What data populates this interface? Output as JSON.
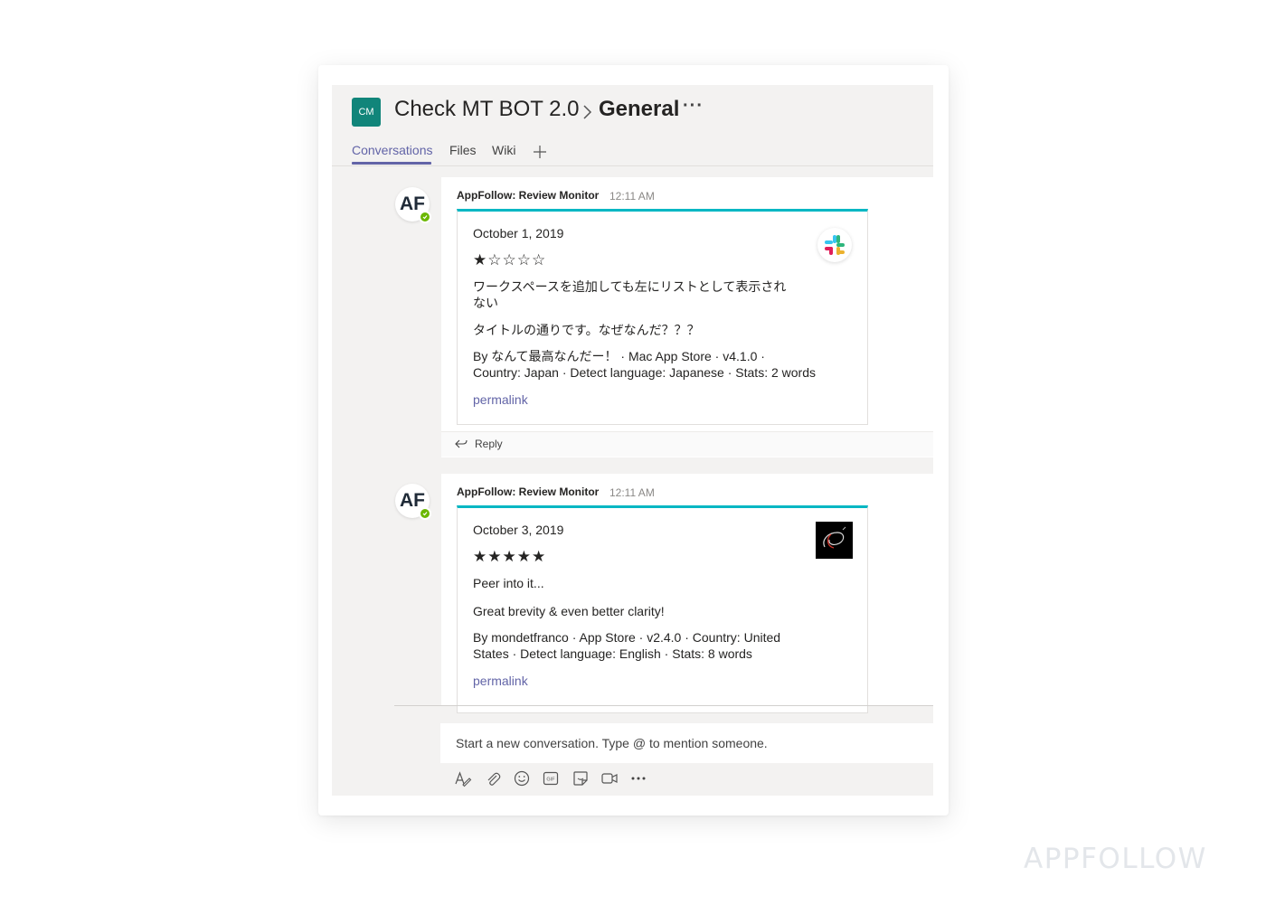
{
  "header": {
    "team_avatar": "CM",
    "team_name": "Check MT BOT 2.0",
    "channel_name": "General",
    "more": "···"
  },
  "tabs": [
    {
      "label": "Conversations",
      "active": true
    },
    {
      "label": "Files",
      "active": false
    },
    {
      "label": "Wiki",
      "active": false
    }
  ],
  "messages": [
    {
      "avatar": "AF",
      "sender": "AppFollow: Review Monitor",
      "time": "12:11 AM",
      "date": "October 1, 2019",
      "stars": "★☆☆☆☆",
      "rating": 1,
      "title_line1": "ワークスペースを追加しても左にリストとして表示され",
      "title_line2": "ない",
      "body": "タイトルの通りです。なぜなんだ？？？",
      "meta_line1": "By なんて最高なんだー！ · Mac App Store · v4.1.0 ·",
      "meta_line2": "Country: Japan · Detect language: Japanese · Stats: 2 words",
      "permalink": "permalink",
      "app_icon": "slack-icon",
      "reply": "Reply"
    },
    {
      "avatar": "AF",
      "sender": "AppFollow: Review Monitor",
      "time": "12:11 AM",
      "date": "October 3, 2019",
      "stars": "★★★★★",
      "rating": 5,
      "title_line1": "Peer into it...",
      "body": "Great brevity & even better clarity!",
      "meta_line1": "By mondetfranco · App Store · v2.4.0 · Country: United",
      "meta_line2": "States · Detect language: English · Stats: 8 words",
      "permalink": "permalink",
      "app_icon": "dark-app-icon"
    }
  ],
  "compose": {
    "placeholder": "Start a new conversation. Type @ to mention someone."
  },
  "toolbar": [
    "format-icon",
    "attach-icon",
    "emoji-icon",
    "gif-icon",
    "sticker-icon",
    "meet-now-icon",
    "more-options-icon"
  ],
  "watermark": "APPFOLLOW",
  "colors": {
    "accent": "#6264a7",
    "team_avatar": "#11857a",
    "card_top_border": "#00b7c3",
    "presence": "#6bb700"
  }
}
